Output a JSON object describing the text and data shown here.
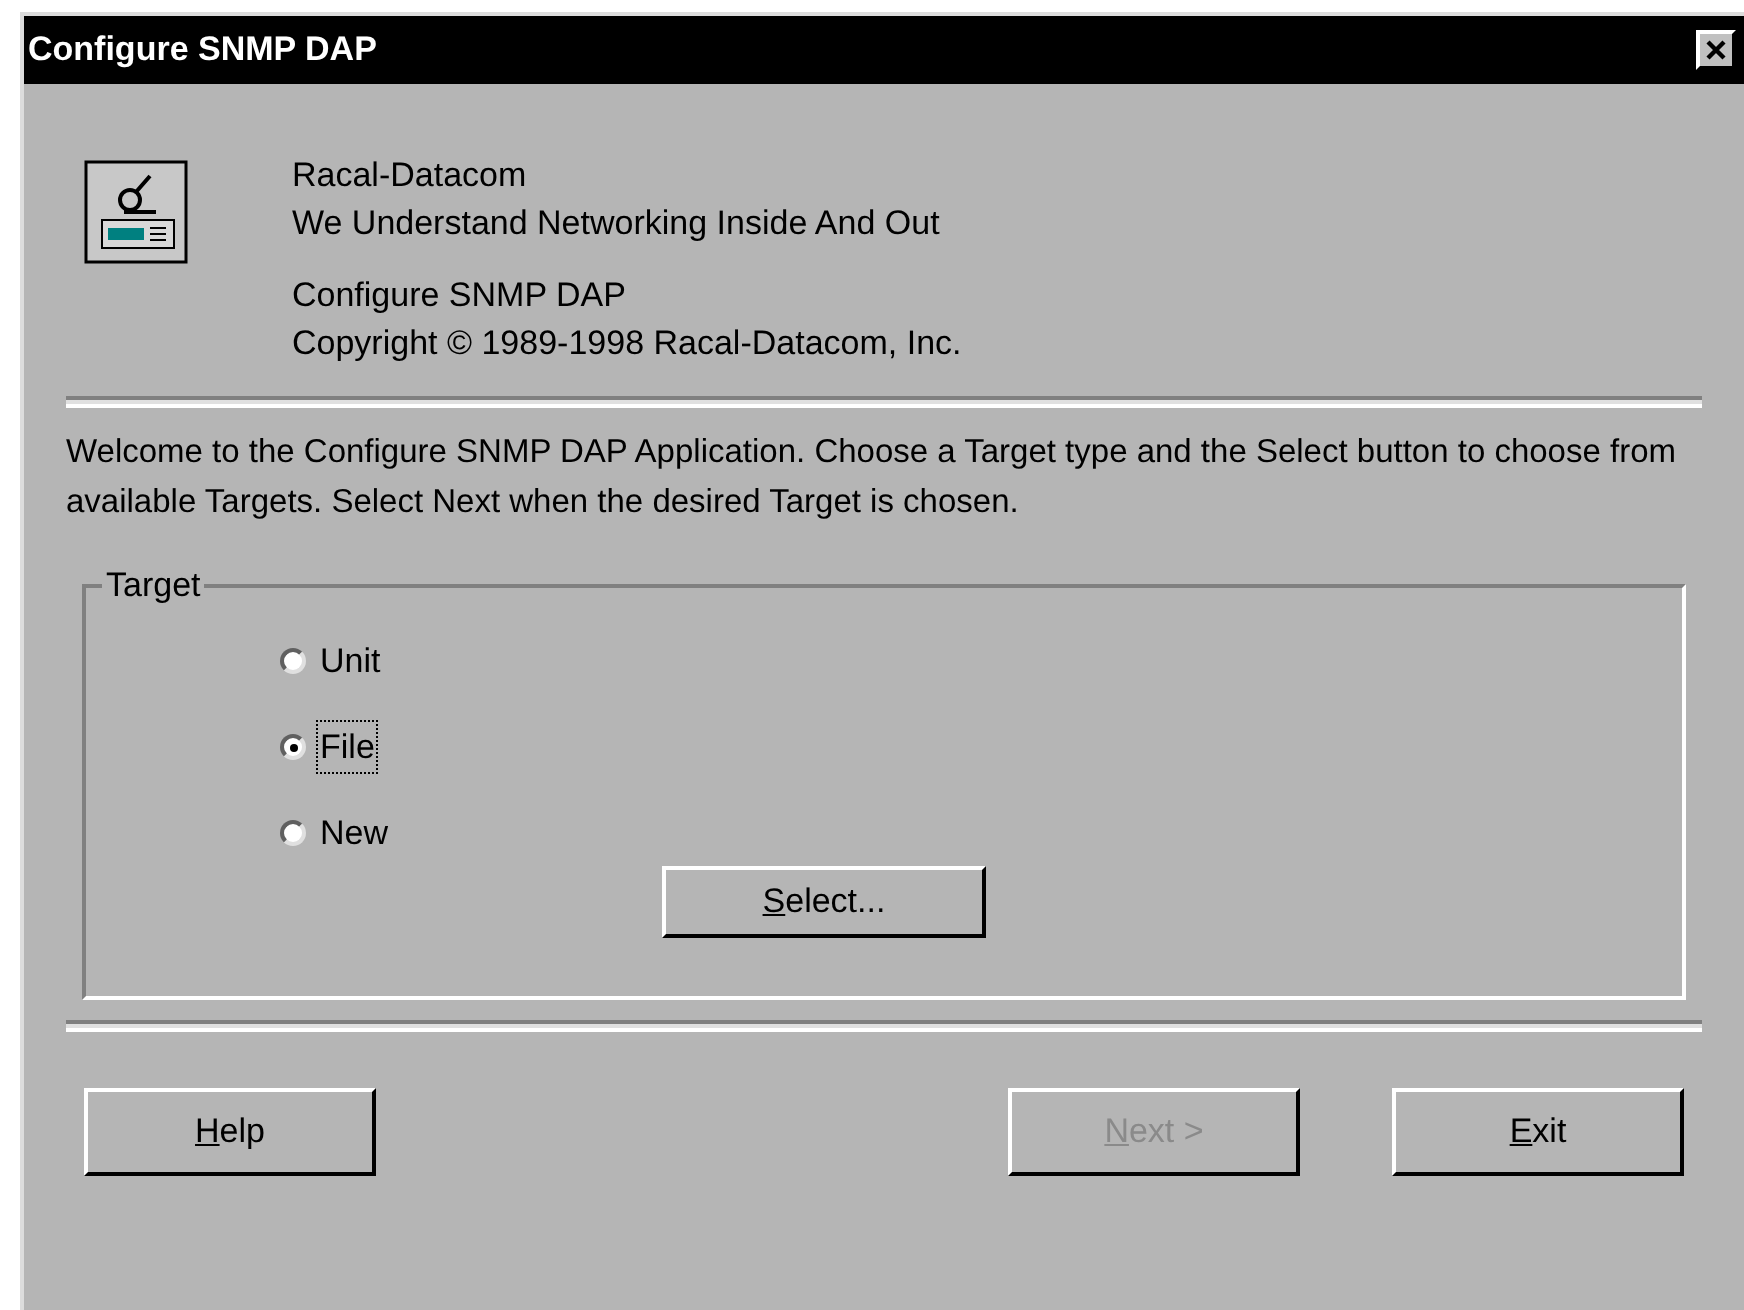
{
  "window": {
    "title": "Configure SNMP DAP"
  },
  "header": {
    "lines": [
      "Racal-Datacom",
      "We Understand Networking Inside And Out"
    ],
    "product_lines": [
      "Configure SNMP DAP",
      "Copyright © 1989-1998  Racal-Datacom, Inc."
    ]
  },
  "intro": "Welcome to the Configure SNMP DAP Application.  Choose a Target type and the Select button to choose from available Targets.  Select Next when the desired Target is chosen.",
  "target": {
    "label": "Target",
    "options": [
      {
        "label": "Unit",
        "selected": false
      },
      {
        "label": "File",
        "selected": true
      },
      {
        "label": "New",
        "selected": false
      }
    ],
    "select_button": "Select..."
  },
  "buttons": [
    {
      "label": "Help",
      "disabled": false
    },
    {
      "label": "Next >",
      "disabled": true
    },
    {
      "label": "Exit",
      "disabled": false
    }
  ]
}
